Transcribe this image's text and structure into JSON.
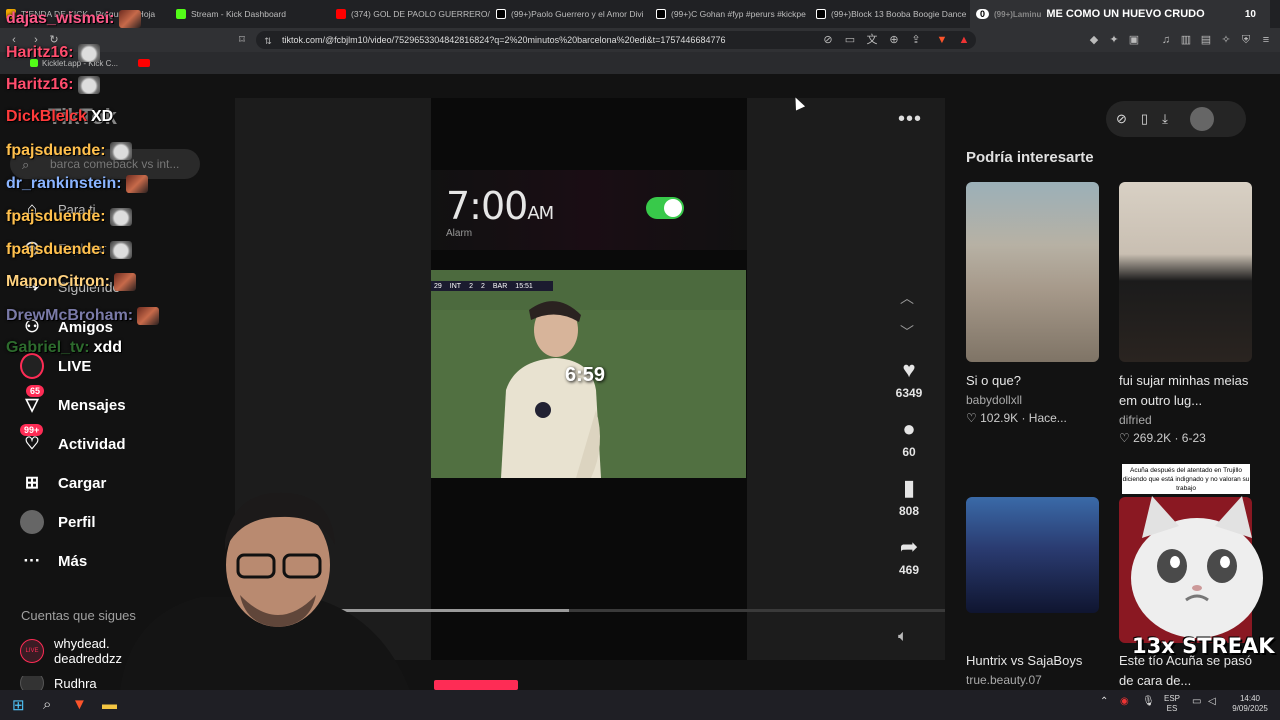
{
  "browser": {
    "tabs": [
      {
        "label": "TIENDA DE KICK - Pregunta - Hoja",
        "color": "#f2a900"
      },
      {
        "label": "Stream - Kick Dashboard",
        "color": "#53fc18"
      },
      {
        "label": "(374) GOL DE PAOLO GUERRERO/ PE",
        "color": "#ff0000"
      },
      {
        "label": "(99+)Paolo Guerrero y el Amor Divi",
        "color": "#ffffff"
      },
      {
        "label": "(99+)C Gohan #fyp #perurs #kickpe",
        "color": "#ffffff"
      },
      {
        "label": "(99+)Block 13 Booba Boogie Dance",
        "color": "#ffffff"
      },
      {
        "label": "(99+)Laminu",
        "color": "#ffffff"
      }
    ],
    "tab_counter": "0",
    "tab_title_right": "ME COMO UN HUEVO CRUDO",
    "tab_count_right": "10",
    "url": "tiktok.com/@fcbjlm10/video/7529653304842816824?q=2%20minutos%20barcelona%20edi&t=1757446684776",
    "bookmark": "Kicklet.app - Kick C..."
  },
  "chat": [
    {
      "user": "dajas_wismei:",
      "color": "#ff5a8a",
      "emote": "face",
      "msg": ""
    },
    {
      "user": "Haritz16:",
      "color": "#ff4d6d",
      "emote": "cat",
      "msg": ""
    },
    {
      "user": "Haritz16:",
      "color": "#ff4d6d",
      "emote": "cat",
      "msg": ""
    },
    {
      "user": "DickBlelck",
      "color": "#ff3b3b",
      "emote": "",
      "msg": "XD"
    },
    {
      "user": "fpajsduende:",
      "color": "#ffc04d",
      "emote": "cat",
      "msg": ""
    },
    {
      "user": "dr_rankinstein:",
      "color": "#8ab4ff",
      "emote": "face",
      "msg": ""
    },
    {
      "user": "fpajsduende:",
      "color": "#ffc04d",
      "emote": "cat",
      "msg": ""
    },
    {
      "user": "fpajsduende:",
      "color": "#ffc04d",
      "emote": "cat",
      "msg": ""
    },
    {
      "user": "ManonCitron:",
      "color": "#ffd27f",
      "emote": "face",
      "msg": ""
    },
    {
      "user": "DrewMcBroham:",
      "color": "#7a7aa8",
      "emote": "face",
      "msg": ""
    },
    {
      "user": "Gabriel_tv:",
      "color": "#2d6b2d",
      "emote": "",
      "msg": "xdd"
    }
  ],
  "tiktok": {
    "logo": "TikTok",
    "search_placeholder": "barca comeback vs int...",
    "nav": [
      {
        "label": "Para ti",
        "icon": "home-icon",
        "glyph": "⌂",
        "badge": ""
      },
      {
        "label": "Explorar",
        "icon": "compass-icon",
        "glyph": "◎",
        "badge": ""
      },
      {
        "label": "Siguiendo",
        "icon": "following-icon",
        "glyph": "⇢",
        "badge": ""
      },
      {
        "label": "Amigos",
        "icon": "friends-icon",
        "glyph": "👥",
        "badge": ""
      },
      {
        "label": "LIVE",
        "icon": "live-icon",
        "glyph": "◉",
        "badge": ""
      },
      {
        "label": "Mensajes",
        "icon": "messages-icon",
        "glyph": "▽",
        "badge": "65"
      },
      {
        "label": "Actividad",
        "icon": "activity-icon",
        "glyph": "♡",
        "badge": "99+"
      },
      {
        "label": "Cargar",
        "icon": "upload-icon",
        "glyph": "⊞",
        "badge": ""
      },
      {
        "label": "Perfil",
        "icon": "profile-icon",
        "glyph": "●",
        "badge": ""
      },
      {
        "label": "Más",
        "icon": "more-icon",
        "glyph": "···",
        "badge": ""
      }
    ],
    "following_header": "Cuentas que sigues",
    "following": [
      {
        "name": "whydead.",
        "sub": "deadreddzz",
        "tag": "LIVE"
      },
      {
        "name": "Rudhra",
        "sub": "",
        "tag": ""
      }
    ]
  },
  "video": {
    "alarm_time": "7:00",
    "alarm_ampm": "AM",
    "alarm_label": "Alarm",
    "score_text": [
      "29",
      "INT",
      "2",
      "2",
      "BAR",
      "15:51"
    ],
    "countdown": "6:59",
    "progress": 0.47,
    "elapsed": "0",
    "likes": "6349",
    "comments": "60",
    "saves": "808",
    "shares": "469"
  },
  "recommendations": {
    "title": "Podría interesarte",
    "cards": [
      {
        "title": "Si o que?",
        "author": "babydollxll",
        "stats": "♡ 102.9K · Hace..."
      },
      {
        "title": "fui sujar minhas meias em outro lug...",
        "author": "difried",
        "stats": "♡ 269.2K · 6-23"
      },
      {
        "title": "Huntrix vs SajaBoys",
        "author": "true.beauty.07",
        "stats": ""
      },
      {
        "title": "Este tío Acuña se pasó de cara de...",
        "author": "",
        "stats": ""
      }
    ]
  },
  "overlay": {
    "streak": "13x STREAK",
    "caption": "Acuña después del atentado en Trujillo diciendo que está indignado y no valoran su trabajo"
  },
  "taskbar": {
    "lang": "ESP",
    "lang2": "ES",
    "time": "14:40",
    "date": "9/09/2025"
  }
}
